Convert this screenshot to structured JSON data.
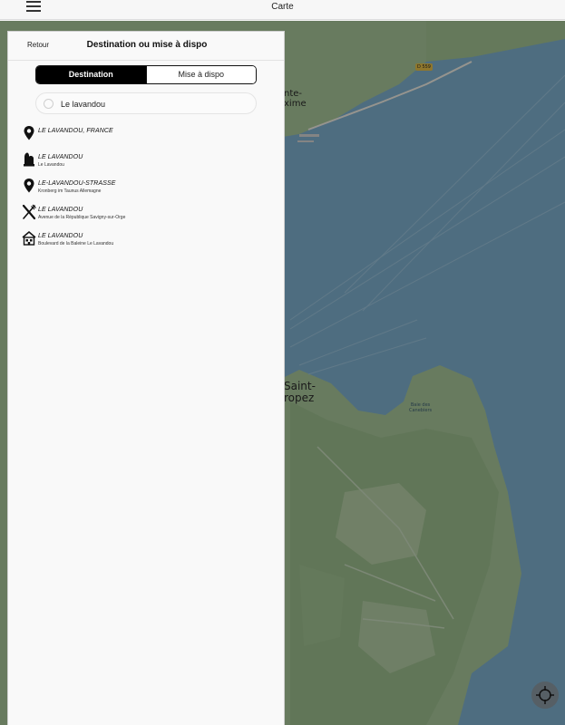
{
  "topbar": {
    "title": "Carte"
  },
  "map": {
    "labels": {
      "sainte_maxime_top": "nte-",
      "sainte_maxime_bottom": "xime",
      "saint_tropez_top": "Saint-",
      "saint_tropez_bottom": "ropez",
      "road_sign": "D 559",
      "bay_top": "Baie des",
      "bay_bottom": "Canebiers"
    },
    "colors": {
      "land": "#a8c79a",
      "water": "#7fb1cf"
    }
  },
  "panel": {
    "back_label": "Retour",
    "title": "Destination ou mise à dispo",
    "tabs": {
      "destination": "Destination",
      "mise_a_dispo": "Mise à dispo"
    },
    "search": {
      "value": "Le lavandou"
    },
    "results": [
      {
        "icon": "map-pin-icon",
        "title": "LE LAVANDOU, FRANCE",
        "subtitle": ""
      },
      {
        "icon": "bell-tower-icon",
        "title": "LE LAVANDOU",
        "subtitle": "Le Lavandou"
      },
      {
        "icon": "map-pin-icon",
        "title": "LE-LAVANDOU-STRASSE",
        "subtitle": "Kronberg im Taunus Allemagne"
      },
      {
        "icon": "fork-knife-icon",
        "title": "LE LAVANDOU",
        "subtitle": "Avenue de la République Savigny-sur-Orge"
      },
      {
        "icon": "hotel-icon",
        "title": "LE LAVANDOU",
        "subtitle": "Boulevard de la Baleine Le Lavandou"
      }
    ]
  }
}
